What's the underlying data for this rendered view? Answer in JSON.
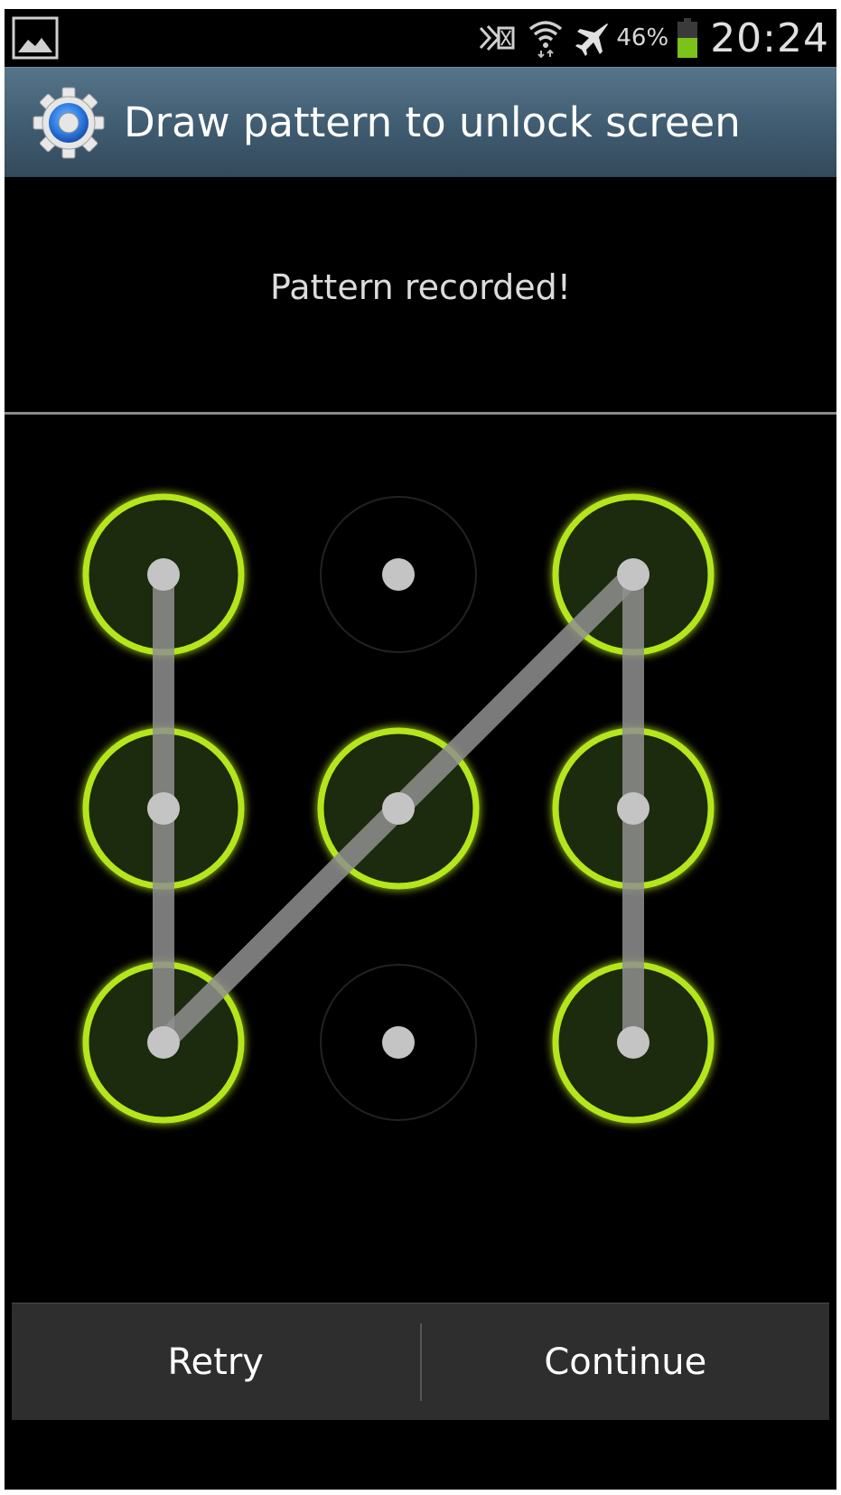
{
  "status_bar": {
    "battery_percent": "46%",
    "time": "20:24",
    "icons": [
      "gallery-icon",
      "nfc-icon",
      "wifi-icon",
      "airplane-mode-icon",
      "battery-icon"
    ],
    "battery_color": "#7bc21a"
  },
  "title_bar": {
    "title": "Draw pattern to unlock screen",
    "icon": "settings-gear-icon"
  },
  "message": "Pattern recorded!",
  "pattern": {
    "grid_size": 3,
    "selected_nodes": [
      1,
      4,
      7,
      5,
      3,
      6,
      9
    ],
    "accent_color": "#b5e61d",
    "line_color": "#8f8f8f"
  },
  "buttons": {
    "retry_label": "Retry",
    "continue_label": "Continue"
  }
}
